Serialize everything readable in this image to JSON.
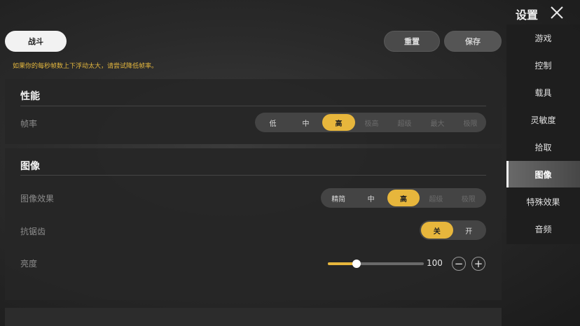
{
  "header": {
    "active_tab": "战斗",
    "reset_label": "重置",
    "save_label": "保存",
    "warning": "如果你的每秒帧数上下浮动太大，请尝试降低帧率。"
  },
  "performance": {
    "title": "性能",
    "frame_rate": {
      "label": "帧率",
      "options": [
        "低",
        "中",
        "高",
        "极高",
        "超级",
        "最大",
        "极限"
      ],
      "selected": "高"
    }
  },
  "graphics": {
    "title": "图像",
    "quality": {
      "label": "图像效果",
      "options": [
        "精简",
        "中",
        "高",
        "超级",
        "极限"
      ],
      "selected": "高"
    },
    "anti_aliasing": {
      "label": "抗锯齿",
      "options": [
        "关",
        "开"
      ],
      "selected": "关"
    },
    "brightness": {
      "label": "亮度",
      "value": "100",
      "min": 0,
      "max": 100,
      "fill_fraction": 0.3,
      "minus": "−",
      "plus": "+"
    }
  },
  "sidebar": {
    "title": "设置",
    "close_icon": "close-icon",
    "items": [
      {
        "label": "游戏"
      },
      {
        "label": "控制"
      },
      {
        "label": "载具"
      },
      {
        "label": "灵敏度"
      },
      {
        "label": "拾取"
      },
      {
        "label": "图像"
      },
      {
        "label": "特殊效果"
      },
      {
        "label": "音频"
      }
    ],
    "active": "图像"
  },
  "colors": {
    "accent": "#e7b63c",
    "warning": "#e4b73e"
  }
}
